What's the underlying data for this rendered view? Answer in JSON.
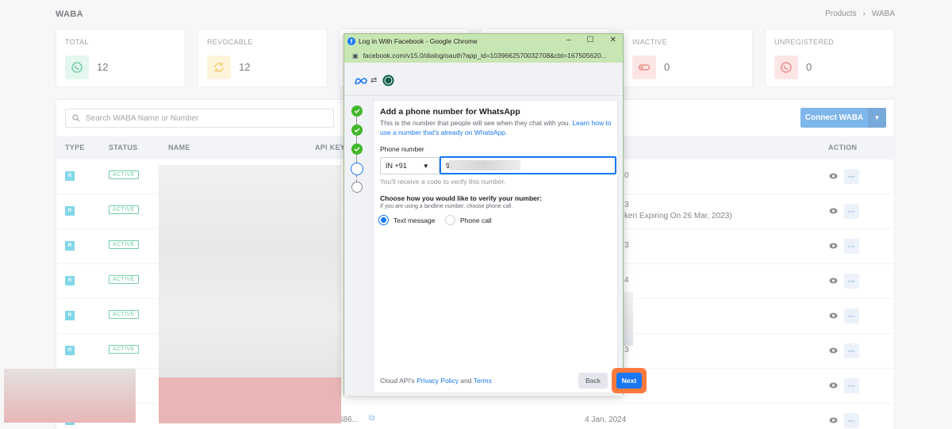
{
  "header": {
    "title": "WABA",
    "breadcrumb": [
      "Products",
      "›",
      "WABA"
    ]
  },
  "stats": [
    {
      "label": "TOTAL",
      "value": "12",
      "icon": "whatsapp-icon",
      "color": "#2bb673"
    },
    {
      "label": "REVOCABLE",
      "value": "12",
      "icon": "refresh-icon",
      "color": "#f0b429"
    },
    {
      "label": "INACTIVE",
      "value": "0",
      "icon": "toggle-off-icon",
      "color": "#e5504a"
    },
    {
      "label": "UNREGISTERED",
      "value": "0",
      "icon": "whatsapp-icon",
      "color": "#e5504a"
    }
  ],
  "toolbar": {
    "search_placeholder": "Search WABA Name or Number",
    "connect_label": "Connect WABA"
  },
  "table": {
    "columns": [
      "TYPE",
      "STATUS",
      "NAME",
      "API KEY",
      "ACTION"
    ],
    "rows": [
      {
        "type": "R",
        "status": "ACTIVE",
        "right_text": "0",
        "right_sub": ""
      },
      {
        "type": "R",
        "status": "ACTIVE",
        "right_text": "3",
        "right_sub": "ken Expiring On 26 Mar, 2023)"
      },
      {
        "type": "R",
        "status": "ACTIVE",
        "right_text": "3",
        "right_sub": ""
      },
      {
        "type": "R",
        "status": "ACTIVE",
        "right_text": "4",
        "right_sub": ""
      },
      {
        "type": "R",
        "status": "ACTIVE",
        "right_text": "",
        "right_sub": ""
      },
      {
        "type": "R",
        "status": "ACTIVE",
        "right_text": "3",
        "right_sub": ""
      },
      {
        "type": "R",
        "status": "",
        "right_text": "",
        "right_sub": ""
      },
      {
        "type": "R",
        "status": "",
        "api": "686...",
        "right_text": "4 Jan, 2024",
        "right_sub": ""
      }
    ]
  },
  "popup": {
    "window_title": "Log in With Facebook - Google Chrome",
    "url": "facebook.com/v15.0/dialog/oauth?app_id=1039662570032708&cbt=167505620...",
    "heading": "Add a phone number for WhatsApp",
    "description": "This is the number that people will see when they chat with you.",
    "description_link": "Learn how to use a number that's already on WhatsApp.",
    "phone_label": "Phone number",
    "country_code": "IN +91",
    "phone_value": "9",
    "hint": "You'll receive a code to verify this number.",
    "verify_heading": "Choose how you would like to verify your number:",
    "verify_sub": "If you are using a landline number, choose phone call.",
    "option_text": "Text message",
    "option_call": "Phone call",
    "footer_prefix": "Cloud API's",
    "footer_privacy": "Privacy Policy",
    "footer_and": "and",
    "footer_terms": "Terms",
    "back_label": "Back",
    "next_label": "Next"
  }
}
